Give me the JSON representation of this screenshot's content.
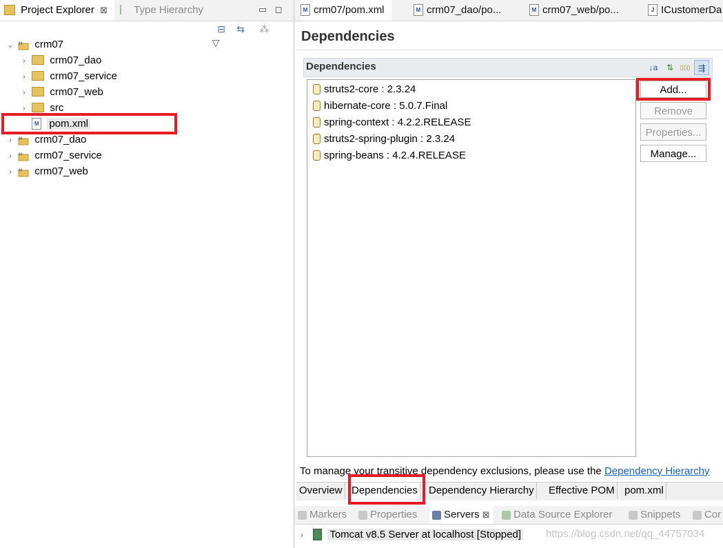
{
  "explorer": {
    "tabs": [
      {
        "label": "Project Explorer",
        "close": "⊠",
        "icon": "project-explorer-icon"
      },
      {
        "label": "Type Hierarchy",
        "icon": "type-hierarchy-icon"
      }
    ],
    "minimize_symbol": "▭",
    "maximize_symbol": "◻",
    "toolbar": {
      "collapse_all": "⊟",
      "link_editor": "⇆",
      "filter": "⁂",
      "view_menu": "▽"
    },
    "tree": [
      {
        "label": "crm07",
        "level": 0,
        "expanded": true,
        "icon": "maven-project-icon"
      },
      {
        "label": "crm07_dao",
        "level": 1,
        "icon": "folder-icon"
      },
      {
        "label": "crm07_service",
        "level": 1,
        "icon": "folder-icon"
      },
      {
        "label": "crm07_web",
        "level": 1,
        "icon": "folder-icon"
      },
      {
        "label": "src",
        "level": 1,
        "icon": "folder-icon"
      },
      {
        "label": "pom.xml",
        "level": 1,
        "icon": "pom-file-icon",
        "selected": true
      },
      {
        "label": "crm07_dao",
        "level": 0,
        "icon": "maven-project-icon"
      },
      {
        "label": "crm07_service",
        "level": 0,
        "icon": "maven-project-icon"
      },
      {
        "label": "crm07_web",
        "level": 0,
        "icon": "maven-project-icon"
      }
    ],
    "pom_icon_letter": "M"
  },
  "editor": {
    "tabs": [
      {
        "label": "crm07/pom.xml",
        "icon": "pom-file-icon"
      },
      {
        "label": "crm07_dao/po...",
        "icon": "pom-file-icon"
      },
      {
        "label": "crm07_web/po...",
        "icon": "pom-file-icon"
      },
      {
        "label": "ICustomerDa",
        "icon": "java-interface-icon"
      }
    ],
    "java_icon_letter": "J",
    "page_title": "Dependencies",
    "section": {
      "title": "Dependencies",
      "tools": {
        "sort": "↓a",
        "hierarchy": "⇅",
        "show_group": "▯▯▯",
        "filter": "⇶"
      }
    },
    "dependencies": [
      "struts2-core : 2.3.24",
      "hibernate-core : 5.0.7.Final",
      "spring-context : 4.2.2.RELEASE",
      "struts2-spring-plugin : 2.3.24",
      "spring-beans : 4.2.4.RELEASE"
    ],
    "buttons": {
      "add": "Add...",
      "remove": "Remove",
      "properties": "Properties...",
      "manage": "Manage..."
    },
    "hint_text": "To manage your transitive dependency exclusions, please use the ",
    "hint_link": "Dependency Hierarchy",
    "page_tabs": [
      "Overview",
      "Dependencies",
      "Dependency Hierarchy",
      "Effective POM",
      "pom.xml"
    ],
    "active_page_tab": "Dependencies"
  },
  "bottom": {
    "tabs": [
      {
        "label": "Markers",
        "icon": "markers-icon"
      },
      {
        "label": "Properties",
        "icon": "properties-icon"
      },
      {
        "label": "Servers",
        "icon": "servers-icon",
        "active": true,
        "close": "⊠"
      },
      {
        "label": "Data Source Explorer",
        "icon": "data-source-icon"
      },
      {
        "label": "Snippets",
        "icon": "snippets-icon"
      },
      {
        "label": "Cor",
        "icon": "console-icon"
      }
    ],
    "server_entry": "Tomcat v8.5 Server at localhost  [Stopped]"
  },
  "watermark": "https://blog.csdn.net/qq_44757034"
}
